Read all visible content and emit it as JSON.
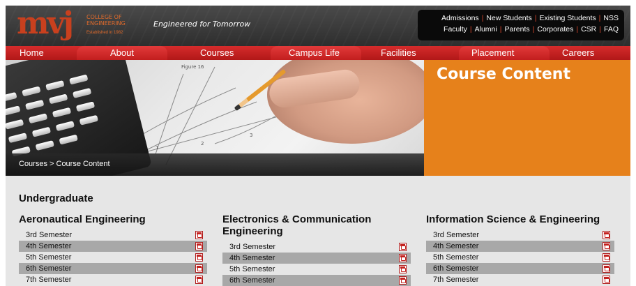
{
  "header": {
    "logo_mark": "mvj",
    "logo_lines": [
      "College of",
      "Engineering"
    ],
    "logo_est": "Established in 1982",
    "tagline": "Engineered for Tomorrow",
    "top_links_row1": [
      "Admissions",
      "New Students",
      "Existing Students",
      "NSS"
    ],
    "top_links_row2": [
      "Faculty",
      "Alumni",
      "Parents",
      "Corporates",
      "CSR",
      "FAQ"
    ]
  },
  "nav": {
    "items": [
      "Home",
      "About",
      "Courses",
      "Campus Life",
      "Facilities",
      "Placement",
      "Careers"
    ]
  },
  "hero": {
    "breadcrumb": "Courses > Course Content",
    "page_title": "Course Content"
  },
  "content": {
    "section_label": "Undergraduate",
    "columns": [
      {
        "title": "Aeronautical Engineering",
        "semesters": [
          "3rd Semester",
          "4th Semester",
          "5th Semester",
          "6th Semester",
          "7th Semester"
        ]
      },
      {
        "title": "Electronics & Communication Engineering",
        "title_line1": "Electronics & Communication",
        "title_line2": "Engineering",
        "semesters": [
          "3rd Semester",
          "4th Semester",
          "5th Semester",
          "6th Semester"
        ]
      },
      {
        "title": "Information Science & Engineering",
        "semesters": [
          "3rd Semester",
          "4th Semester",
          "5th Semester",
          "6th Semester",
          "7th Semester"
        ]
      }
    ]
  },
  "colors": {
    "brand_red": "#c21e1e",
    "accent_orange": "#e6811b",
    "row_alt": "#a8a8a8",
    "page_bg": "#e6e6e6"
  },
  "icons": {
    "download": "pdf-icon"
  }
}
